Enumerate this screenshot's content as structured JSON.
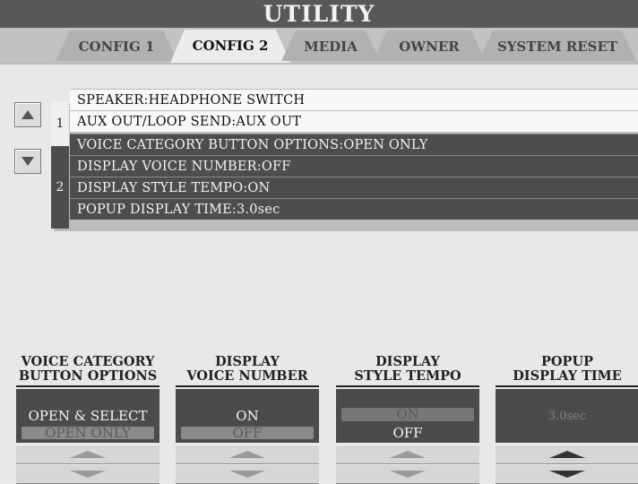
{
  "window": {
    "title": "UTILITY"
  },
  "tabs": [
    {
      "label": "CONFIG 1",
      "active": false
    },
    {
      "label": "CONFIG 2",
      "active": true
    },
    {
      "label": "MEDIA",
      "active": false
    },
    {
      "label": "OWNER",
      "active": false
    },
    {
      "label": "SYSTEM RESET",
      "active": false
    }
  ],
  "pages": {
    "page1": "1",
    "page2": "2"
  },
  "settings": [
    {
      "text": "SPEAKER:HEADPHONE SWITCH",
      "page": 1
    },
    {
      "text": "AUX OUT/LOOP SEND:AUX OUT",
      "page": 1
    },
    {
      "text": "VOICE CATEGORY BUTTON OPTIONS:OPEN ONLY",
      "page": 2
    },
    {
      "text": "DISPLAY VOICE NUMBER:OFF",
      "page": 2
    },
    {
      "text": "DISPLAY STYLE TEMPO:ON",
      "page": 2
    },
    {
      "text": "POPUP DISPLAY TIME:3.0sec",
      "page": 2
    }
  ],
  "controls": [
    {
      "title_line1": "VOICE CATEGORY",
      "title_line2": "BUTTON OPTIONS",
      "options": [
        "OPEN & SELECT",
        "OPEN ONLY"
      ],
      "selected": "OPEN ONLY"
    },
    {
      "title_line1": "DISPLAY",
      "title_line2": "VOICE NUMBER",
      "options": [
        "ON",
        "OFF"
      ],
      "selected": "OFF"
    },
    {
      "title_line1": "DISPLAY",
      "title_line2": "STYLE TEMPO",
      "options": [
        "ON",
        "OFF"
      ],
      "selected": "ON"
    },
    {
      "title_line1": "POPUP",
      "title_line2": "DISPLAY TIME",
      "options": [
        "3.0sec"
      ],
      "selected": "3.0sec"
    }
  ],
  "colors": {
    "title_bar": "#585858",
    "selected_row": "#4d4d4d",
    "panel": "#4b4b4b"
  }
}
